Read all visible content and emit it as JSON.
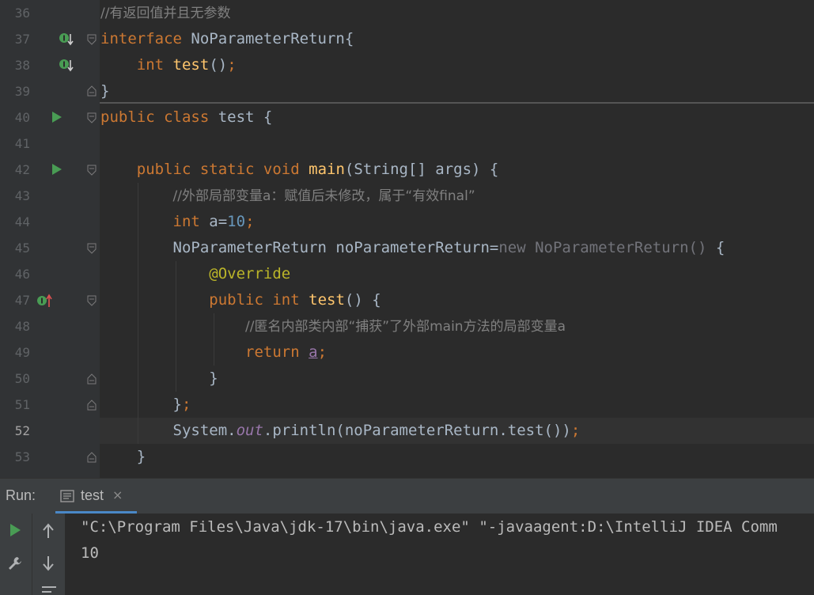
{
  "editor": {
    "line_numbers": [
      "36",
      "37",
      "38",
      "39",
      "40",
      "41",
      "42",
      "43",
      "44",
      "45",
      "46",
      "47",
      "48",
      "49",
      "50",
      "51",
      "52",
      "53"
    ],
    "current_line": "52",
    "lines": {
      "l36": {
        "comment": "//有返回值并且无参数"
      },
      "l37": {
        "kw": "interface",
        "name": " NoParameterReturn{"
      },
      "l38": {
        "kw": "int",
        "sp": " ",
        "fn": "test",
        "rest": "()",
        "semi": ";"
      },
      "l39": {
        "brace": "}"
      },
      "l40": {
        "kw": "public class",
        "rest": " test {"
      },
      "l42": {
        "kw": "public static void",
        "sp": " ",
        "fn": "main",
        "rest": "(String[] args) {"
      },
      "l43": {
        "comment": "//外部局部变量a：赋值后未修改，属于“有效final”"
      },
      "l44": {
        "kw": "int",
        "rest": " a=",
        "num": "10",
        "semi": ";"
      },
      "l45": {
        "rest1": "NoParameterReturn noParameterReturn=",
        "dim": "new NoParameterReturn()",
        "rest2": " {"
      },
      "l46": {
        "ann": "@Override"
      },
      "l47": {
        "kw": "public int",
        "sp": " ",
        "fn": "test",
        "rest": "() {"
      },
      "l48": {
        "comment": "//匿名内部类内部“捕获”了外部main方法的局部变量a"
      },
      "l49": {
        "kw": "return",
        "sp": " ",
        "var": "a",
        "semi": ";"
      },
      "l50": {
        "brace": "}"
      },
      "l51": {
        "brace": "}",
        "semi": ";"
      },
      "l52": {
        "a": "System.",
        "st": "out",
        "b": ".println(noParameterReturn.test())",
        "semi": ";"
      },
      "l53": {
        "brace": "}"
      }
    }
  },
  "run": {
    "label": "Run:",
    "tab_name": "test",
    "tab_close": "×",
    "icons": [
      "run-icon",
      "wrench-icon",
      "arrow-up-icon",
      "arrow-down-icon",
      "soft-wrap-icon",
      "console-tab-icon"
    ],
    "output": [
      "\"C:\\Program Files\\Java\\jdk-17\\bin\\java.exe\" \"-javaagent:D:\\IntelliJ IDEA Comm",
      "10"
    ]
  },
  "colors": {
    "background": "#2b2b2b",
    "gutter": "#313335",
    "keyword": "#cc7832",
    "function": "#ffc66d",
    "number": "#6897bb",
    "comment": "#808080",
    "annotation": "#bbb529",
    "static_field": "#9876aa",
    "run_green": "#499c54",
    "tab_underline": "#4a88c7"
  }
}
